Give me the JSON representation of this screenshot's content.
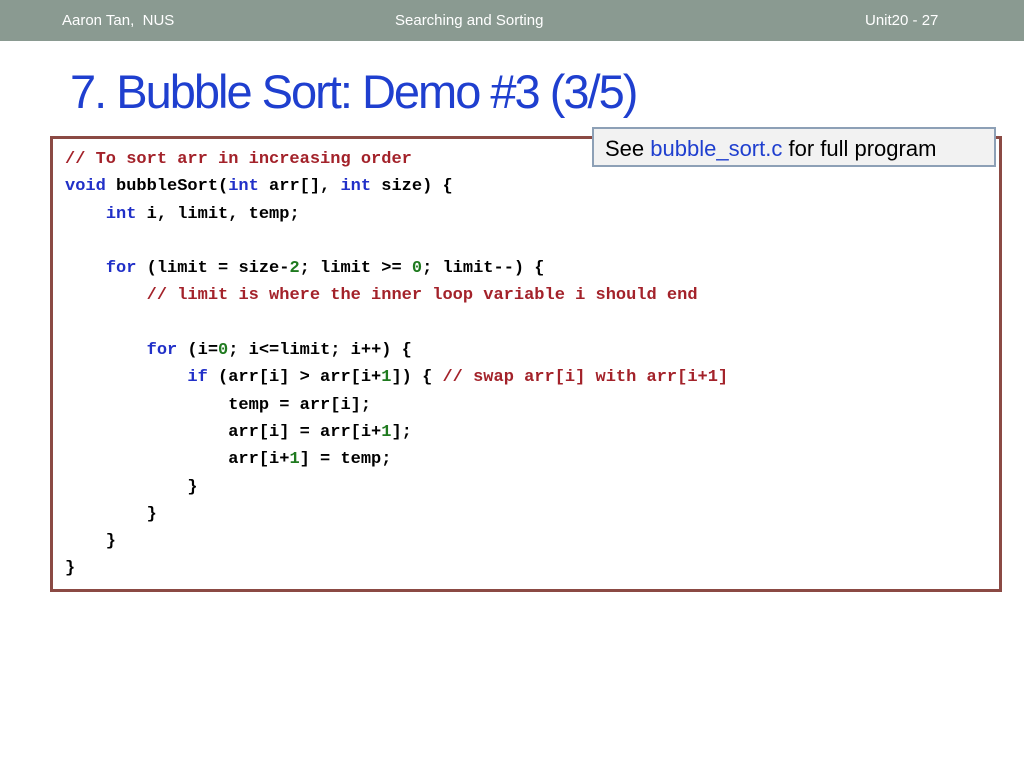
{
  "header": {
    "author": "Aaron Tan,  NUS",
    "topic": "Searching and Sorting",
    "unit": "Unit20 - 27"
  },
  "slide": {
    "title": "7. Bubble Sort: Demo #3 (3/5)"
  },
  "note": {
    "prefix": "See ",
    "filename": "bubble_sort.c",
    "suffix": " for full program"
  },
  "colors": {
    "header_bg": "#8a9a91",
    "title": "#1f3fcf",
    "code_keyword": "#2130c8",
    "code_comment": "#a3222a",
    "code_number": "#1f7a1f",
    "code_border": "#8b4a44",
    "note_border": "#8da0b6"
  },
  "code_lines": [
    [
      {
        "t": "// To sort arr in increasing order",
        "c": "comment"
      }
    ],
    [
      {
        "t": "void",
        "c": "kw"
      },
      {
        "t": " bubbleSort("
      },
      {
        "t": "int",
        "c": "kw"
      },
      {
        "t": " arr[], "
      },
      {
        "t": "int",
        "c": "kw"
      },
      {
        "t": " size) {"
      }
    ],
    [
      {
        "t": "    "
      },
      {
        "t": "int",
        "c": "kw"
      },
      {
        "t": " i, limit, temp;"
      }
    ],
    [],
    [
      {
        "t": "    "
      },
      {
        "t": "for",
        "c": "kw"
      },
      {
        "t": " (limit = size-"
      },
      {
        "t": "2",
        "c": "num"
      },
      {
        "t": "; limit >= "
      },
      {
        "t": "0",
        "c": "num"
      },
      {
        "t": "; limit--) {"
      }
    ],
    [
      {
        "t": "        "
      },
      {
        "t": "// limit is where the inner loop variable i should end",
        "c": "comment"
      }
    ],
    [],
    [
      {
        "t": "        "
      },
      {
        "t": "for",
        "c": "kw"
      },
      {
        "t": " (i="
      },
      {
        "t": "0",
        "c": "num"
      },
      {
        "t": "; i<=limit; i++) {"
      }
    ],
    [
      {
        "t": "            "
      },
      {
        "t": "if",
        "c": "kw"
      },
      {
        "t": " (arr[i] > arr[i+"
      },
      {
        "t": "1",
        "c": "num"
      },
      {
        "t": "]) { "
      },
      {
        "t": "// swap arr[i] with arr[i+1]",
        "c": "comment"
      }
    ],
    [
      {
        "t": "                temp = arr[i];"
      }
    ],
    [
      {
        "t": "                arr[i] = arr[i+"
      },
      {
        "t": "1",
        "c": "num"
      },
      {
        "t": "];"
      }
    ],
    [
      {
        "t": "                arr[i+"
      },
      {
        "t": "1",
        "c": "num"
      },
      {
        "t": "] = temp;"
      }
    ],
    [
      {
        "t": "            }"
      }
    ],
    [
      {
        "t": "        }"
      }
    ],
    [
      {
        "t": "    }"
      }
    ],
    [
      {
        "t": "}"
      }
    ]
  ]
}
